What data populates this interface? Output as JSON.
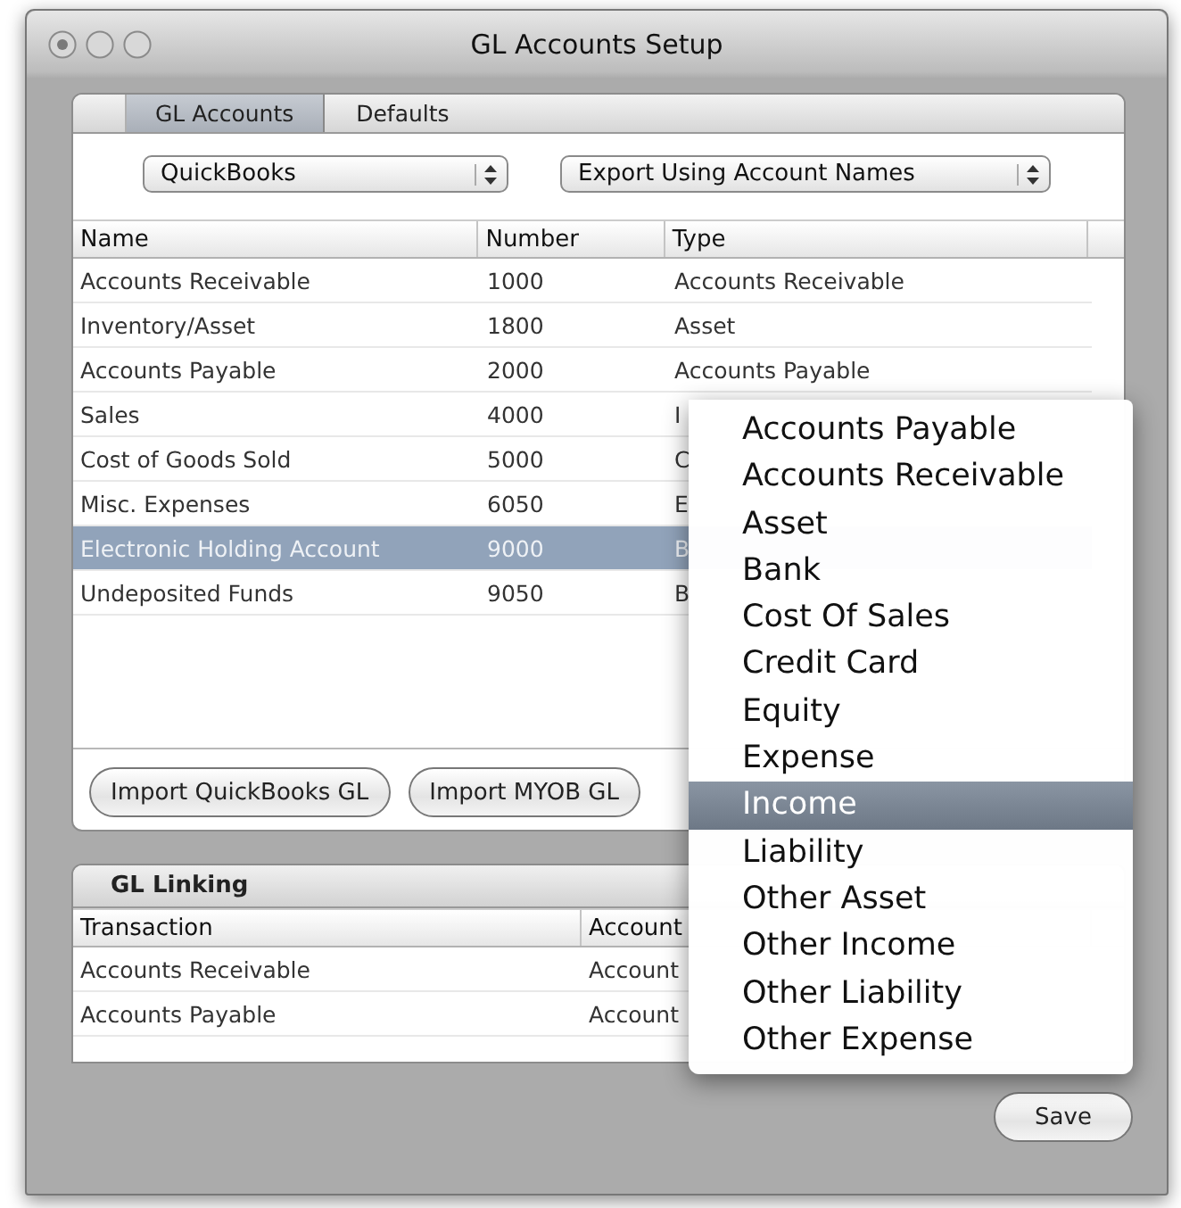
{
  "window": {
    "title": "GL Accounts Setup"
  },
  "tabs": [
    {
      "label": "GL Accounts",
      "selected": true
    },
    {
      "label": "Defaults",
      "selected": false
    }
  ],
  "popups": [
    {
      "value": "QuickBooks"
    },
    {
      "value": "Export Using Account Names"
    }
  ],
  "accounts_table": {
    "columns": [
      "Name",
      "Number",
      "Type"
    ],
    "rows": [
      {
        "name": "Accounts Receivable",
        "number": "1000",
        "type": "Accounts Receivable",
        "selected": false
      },
      {
        "name": "Inventory/Asset",
        "number": "1800",
        "type": "Asset",
        "selected": false
      },
      {
        "name": "Accounts Payable",
        "number": "2000",
        "type": "Accounts Payable",
        "selected": false
      },
      {
        "name": "Sales",
        "number": "4000",
        "type": "I",
        "selected": false
      },
      {
        "name": "Cost of Goods Sold",
        "number": "5000",
        "type": "C",
        "selected": false
      },
      {
        "name": "Misc. Expenses",
        "number": "6050",
        "type": "E",
        "selected": false
      },
      {
        "name": "Electronic Holding Account",
        "number": "9000",
        "type": "B",
        "selected": true
      },
      {
        "name": "Undeposited Funds",
        "number": "9050",
        "type": "B",
        "selected": false
      }
    ]
  },
  "import_buttons": [
    "Import QuickBooks GL",
    "Import MYOB GL"
  ],
  "gl_linking": {
    "title": "GL Linking",
    "columns": [
      "Transaction",
      "Account"
    ],
    "rows": [
      {
        "transaction": "Accounts Receivable",
        "account": "Account"
      },
      {
        "transaction": "Accounts Payable",
        "account": "Account"
      }
    ]
  },
  "type_menu": {
    "items": [
      {
        "label": "Accounts Payable",
        "selected": false
      },
      {
        "label": "Accounts Receivable",
        "selected": false
      },
      {
        "label": "Asset",
        "selected": false
      },
      {
        "label": "Bank",
        "selected": false
      },
      {
        "label": "Cost Of Sales",
        "selected": false
      },
      {
        "label": "Credit Card",
        "selected": false
      },
      {
        "label": "Equity",
        "selected": false
      },
      {
        "label": "Expense",
        "selected": false
      },
      {
        "label": "Income",
        "selected": true
      },
      {
        "label": "Liability",
        "selected": false
      },
      {
        "label": "Other Asset",
        "selected": false
      },
      {
        "label": "Other Income",
        "selected": false
      },
      {
        "label": "Other Liability",
        "selected": false
      },
      {
        "label": "Other Expense",
        "selected": false
      }
    ]
  },
  "save_button": "Save"
}
